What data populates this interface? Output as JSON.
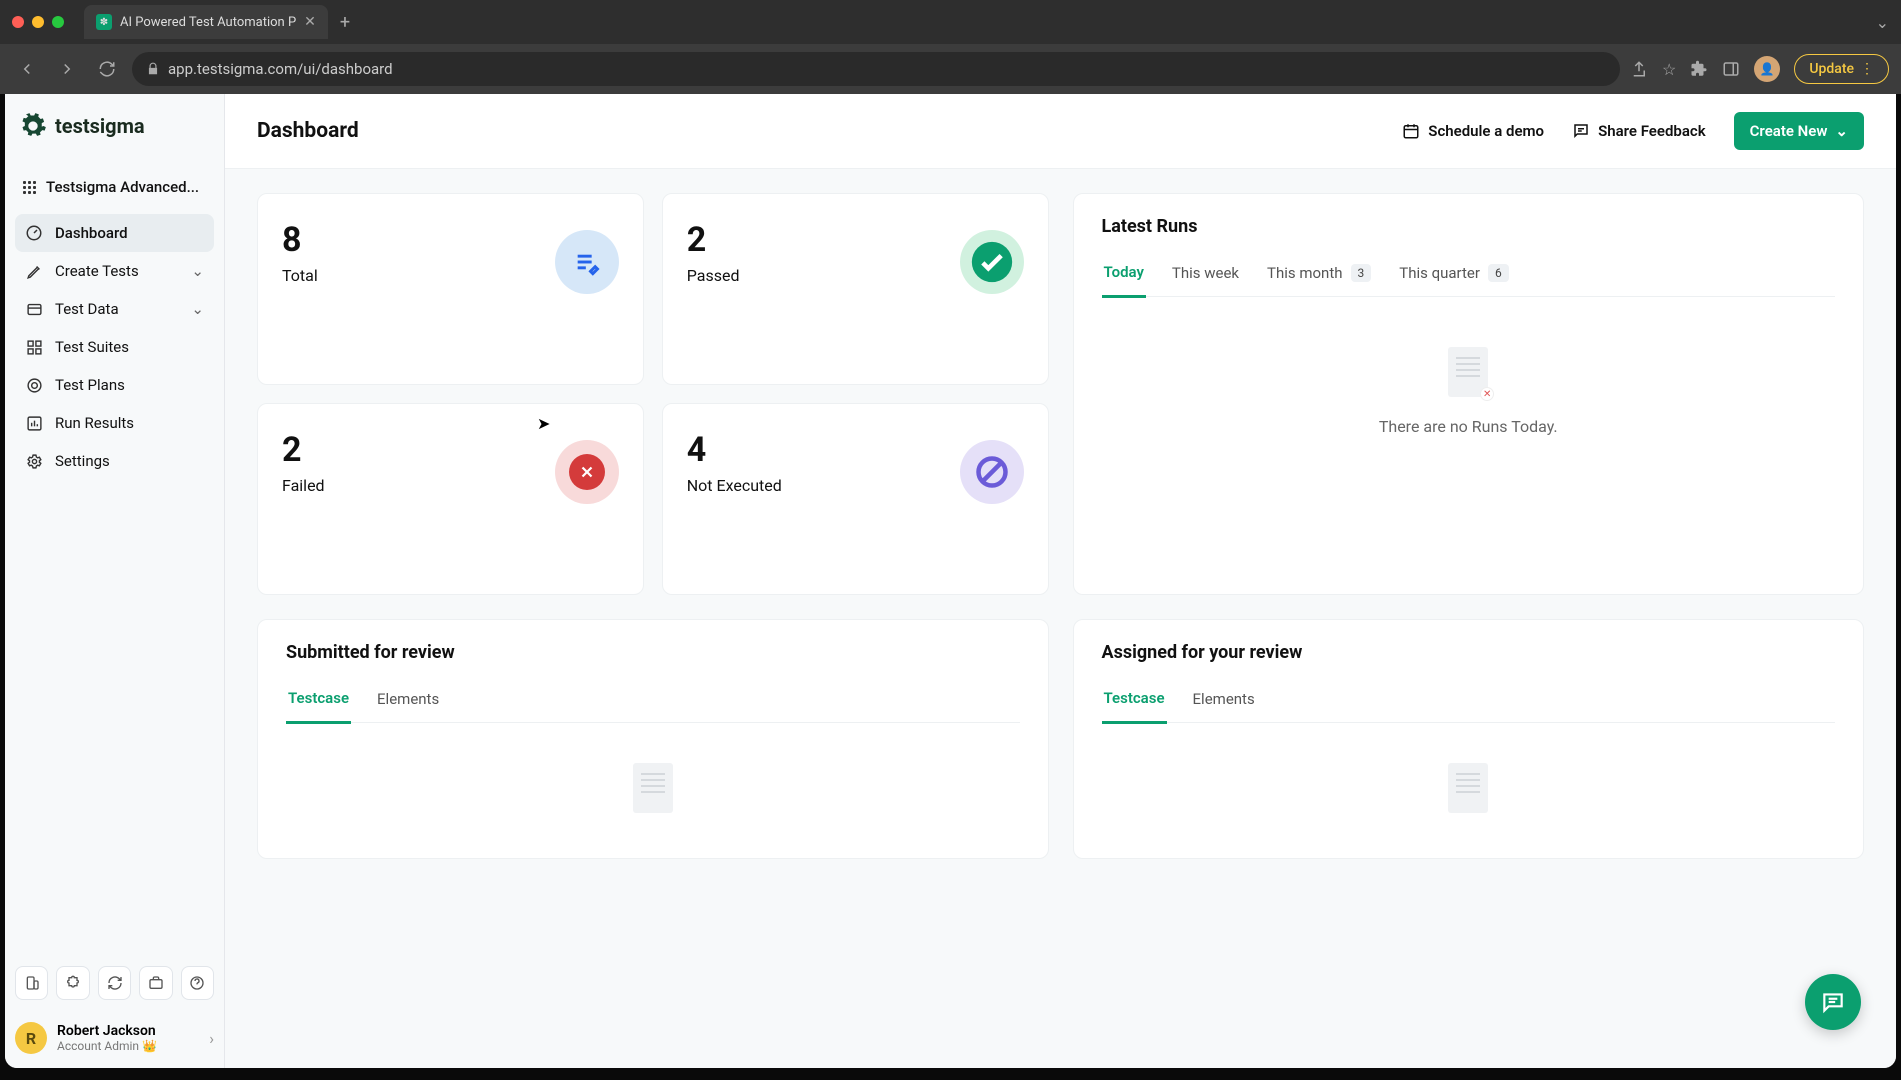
{
  "browser": {
    "tab_title": "AI Powered Test Automation P",
    "url": "app.testsigma.com/ui/dashboard",
    "update_label": "Update"
  },
  "brand": {
    "name": "testsigma"
  },
  "project_switcher": {
    "label": "Testsigma Advanced..."
  },
  "sidebar": {
    "items": [
      {
        "label": "Dashboard"
      },
      {
        "label": "Create Tests"
      },
      {
        "label": "Test Data"
      },
      {
        "label": "Test Suites"
      },
      {
        "label": "Test Plans"
      },
      {
        "label": "Run Results"
      },
      {
        "label": "Settings"
      }
    ]
  },
  "user": {
    "initial": "R",
    "name": "Robert Jackson",
    "role": "Account Admin 👑"
  },
  "header": {
    "title": "Dashboard",
    "schedule_demo": "Schedule a demo",
    "share_feedback": "Share Feedback",
    "create_new": "Create New"
  },
  "stats": {
    "total": {
      "value": "8",
      "label": "Total"
    },
    "passed": {
      "value": "2",
      "label": "Passed"
    },
    "failed": {
      "value": "2",
      "label": "Failed"
    },
    "notexec": {
      "value": "4",
      "label": "Not Executed"
    }
  },
  "latest_runs": {
    "title": "Latest Runs",
    "tabs": {
      "today": "Today",
      "this_week": "This week",
      "this_month": "This month",
      "this_month_count": "3",
      "this_quarter": "This quarter",
      "this_quarter_count": "6"
    },
    "empty": "There are no Runs Today."
  },
  "submitted": {
    "title": "Submitted for review",
    "tab_testcase": "Testcase",
    "tab_elements": "Elements"
  },
  "assigned": {
    "title": "Assigned for your review",
    "tab_testcase": "Testcase",
    "tab_elements": "Elements"
  }
}
